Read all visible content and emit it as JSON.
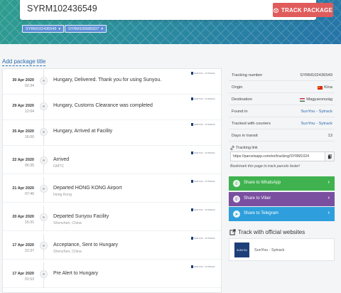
{
  "header": {
    "search_value": "SYRM102436549",
    "track_button_label": "TRACK PACKAGE",
    "chips": [
      {
        "label": "SYRM102436549"
      },
      {
        "label": "SYRM100685937"
      }
    ]
  },
  "add_package_title": "Add package title",
  "events": [
    {
      "date": "30 Apr 2020",
      "time": "02:34",
      "text": "Hungary, Delivered. Thank you for using Sunyou.",
      "location": "",
      "carrier_tag": "SUNYOU · SYTRACK"
    },
    {
      "date": "29 Apr 2020",
      "time": "12:04",
      "text": "Hungary, Customs Clearance was completed",
      "location": "",
      "carrier_tag": "SUNYOU · SYTRACK"
    },
    {
      "date": "25 Apr 2020",
      "time": "16:00",
      "text": "Hungary, Arrived at Facility",
      "location": "",
      "carrier_tag": "SUNYOU · SYTRACK"
    },
    {
      "date": "22 Apr 2020",
      "time": "06:35",
      "text": "Arrived",
      "location": "GMTC",
      "carrier_tag": "SUNYOU · SYTRACK"
    },
    {
      "date": "21 Apr 2020",
      "time": "07:40",
      "text": "Departed HONG KONG Airport",
      "location": "Hong Kong",
      "carrier_tag": "SUNYOU · SYTRACK"
    },
    {
      "date": "20 Apr 2020",
      "time": "15:31",
      "text": "Departed Sunyou Facility",
      "location": "Shenzhen, China",
      "carrier_tag": "SUNYOU · SYTRACK"
    },
    {
      "date": "17 Apr 2020",
      "time": "22:37",
      "text": "Acceptance, Sent to Hungary",
      "location": "Shenzhen, China",
      "carrier_tag": "SUNYOU · SYTRACK"
    },
    {
      "date": "17 Apr 2020",
      "time": "01:53",
      "text": "Pre Alert to Hungary",
      "location": "",
      "carrier_tag": "SUNYOU · SYTRACK"
    }
  ],
  "info": {
    "tracking_number": {
      "label": "Tracking number",
      "value": "SYRM102436549"
    },
    "origin": {
      "label": "Origin",
      "value": "Kína"
    },
    "destination": {
      "label": "Destination",
      "value": "Magyarország"
    },
    "found_in": {
      "label": "Found in",
      "value": "SunYou - Sytrack"
    },
    "tracked_with": {
      "label": "Tracked with couriers",
      "value": "SunYou - Sytrack"
    },
    "days_in_transit": {
      "label": "Days in transit",
      "value": "13"
    }
  },
  "tracking_link": {
    "label": "Tracking link",
    "url": "https://parcelsapp.com/en/tracking/SYRM1024",
    "bookmark_note": "Bookmark this page to track parcels faster!"
  },
  "share": {
    "whatsapp": {
      "label": "Share to WhatsApp",
      "color": "#3fb24f"
    },
    "viber": {
      "label": "Share to Viber",
      "color": "#7a4fa0"
    },
    "telegram": {
      "label": "Share to Telegram",
      "color": "#2e9fdc"
    }
  },
  "official": {
    "title": "Track with official websites",
    "logo_text": "SUNYOU",
    "name": "SunYou - Sytrack"
  },
  "colors": {
    "accent": "#e05b5b",
    "chip": "#5c8fd6",
    "link": "#2b6cb0"
  }
}
